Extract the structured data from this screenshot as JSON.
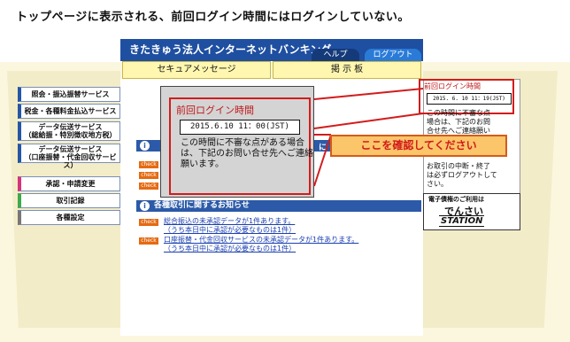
{
  "heading": "トップページに表示される、前回ログイン時間にはログインしていない。",
  "header": {
    "title": "きたきゅう法人インターネットバンキング",
    "help": "ヘルプ",
    "logout": "ログアウト"
  },
  "tabs": [
    {
      "label": "セキュアメッセージ"
    },
    {
      "label": "掲 示 板"
    }
  ],
  "sidebar": {
    "items": [
      {
        "label": "照会・振込振替サービス"
      },
      {
        "label": "税金・各種料金払込サービス"
      },
      {
        "label": "データ伝送サービス\n（総給振・特別徴収地方税）"
      },
      {
        "label": "データ伝送サービス\n（口座振替・代金回収サービス）"
      },
      {
        "label": "承認・申請変更"
      },
      {
        "label": "取引記録"
      },
      {
        "label": "各種設定"
      }
    ]
  },
  "popup": {
    "title": "前回ログイン時間",
    "time": "2015.6.10  11：00(JST)",
    "text": "この時間に不審な点がある場合は、下記のお問い合せ先へご連絡願います。"
  },
  "callout": "ここを確認してください",
  "main": {
    "section_label": "各種取引に関するお知らせ",
    "section_partial": "に",
    "check_label": "check",
    "notices": [
      {
        "line1": "総合振込の未承認データが1件あります。",
        "line2": "（うち本日中に承認が必要なものは1件）"
      },
      {
        "line1": "口座振替・代金回収サービスの未承認データが1件あります。",
        "line2": "（うち本日中に承認が必要なものは1件）"
      }
    ]
  },
  "right_panel": {
    "title": "前回ログイン時間",
    "time": "2015. 6. 10   11：19(JST)",
    "text1_line1": "この時間に不審な点",
    "text1_line2": "場合は、下記のお問",
    "text1_line3": "合せ先へご連絡願い",
    "text2_line1": "お取引の中断・終了",
    "text2_line2": "は必ずログアウトして",
    "text2_line3": "さい。",
    "station_sub": "電子債権のご利用は",
    "station_main": "でんさい",
    "station_logo": "STATION"
  }
}
